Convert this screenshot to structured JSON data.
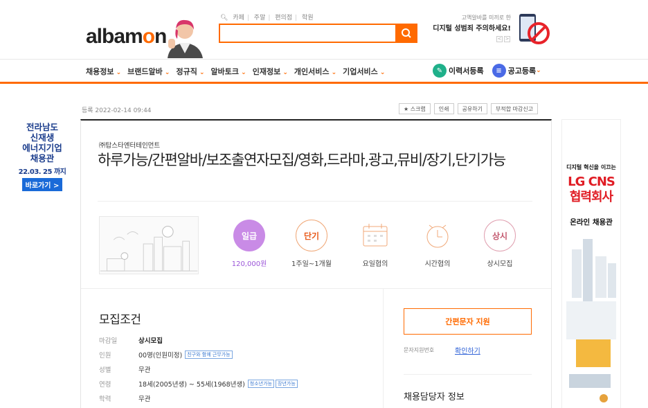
{
  "header": {
    "logo_a": "albam",
    "logo_o": "o",
    "logo_n": "n",
    "top_links": [
      "카페",
      "주말",
      "편의점",
      "학원"
    ],
    "search_placeholder": "",
    "ad_line1": "고액알바를 미끼로 한",
    "ad_line2": "디지털 성범죄 주의하세요!",
    "ad_prev": "<",
    "ad_next": ">"
  },
  "nav": {
    "items": [
      "채용정보",
      "브랜드알바",
      "정규직",
      "알바토크",
      "인재정보",
      "개인서비스",
      "기업서비스"
    ],
    "resume_label": "이력서등록",
    "post_label": "공고등록"
  },
  "left_ad": {
    "line1": "전라남도",
    "line2": "신재생",
    "line3": "에너지기업",
    "line4": "채용관",
    "date": "22.03. 25 까지",
    "button": "바로가기 >"
  },
  "right_ad": {
    "line1": "디지털 혁신을 이끄는",
    "line2": "LG CNS",
    "line3": "협력회사",
    "line4": "온라인 채용관"
  },
  "post": {
    "registered": "등록 2022-02-14 09:44",
    "tools": [
      "★ 스크랩",
      "인쇄",
      "공유하기",
      "부적합 마감신고"
    ],
    "company": "㈜탑스타엔터테인먼트",
    "title": "하루가능/간편알바/보조출연자모집/영화,드라마,광고,뮤비/장기,단기가능",
    "conditions": [
      {
        "badge": "일급",
        "label": "120,000원"
      },
      {
        "badge": "단기",
        "label": "1주일~1개월"
      },
      {
        "badge": "",
        "label": "요일협의"
      },
      {
        "badge": "",
        "label": "시간협의"
      },
      {
        "badge": "상시",
        "label": "상시모집"
      }
    ]
  },
  "recruit": {
    "section_title": "모집조건",
    "rows": [
      {
        "key": "마감일",
        "value": "상시모집",
        "tags": []
      },
      {
        "key": "인원",
        "value": "00명(인원미정)",
        "tags": [
          "친구와 함께 근무가능"
        ]
      },
      {
        "key": "성별",
        "value": "무관",
        "tags": []
      },
      {
        "key": "연령",
        "value": "18세(2005년생) ~ 55세(1968년생)",
        "tags": [
          "청소년가능",
          "장년가능"
        ]
      },
      {
        "key": "학력",
        "value": "무관",
        "tags": []
      }
    ]
  },
  "apply": {
    "sms_button": "간편문자 지원",
    "sms_label": "문자지원번호",
    "sms_link": "확인하기",
    "manager_title": "채용담당자 정보"
  },
  "colors": {
    "accent": "#ff6a00",
    "salary_badge": "#c98be6",
    "link": "#2b5fd6",
    "navy": "#1a3c8c",
    "lg_red": "#e01c24"
  }
}
